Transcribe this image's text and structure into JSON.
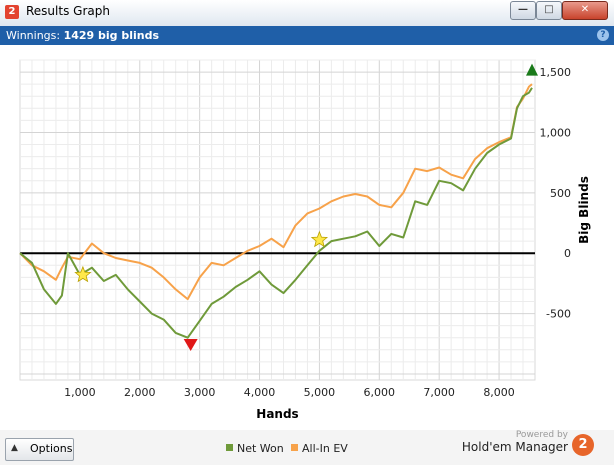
{
  "window": {
    "title": "Results Graph",
    "app_icon": "2",
    "buttons": [
      "minimize",
      "maximize",
      "close"
    ]
  },
  "infobar": {
    "label": "Winnings:",
    "value": "1429 big blinds",
    "help": "?"
  },
  "bottom": {
    "options_label": "Options",
    "powered_by": "Powered by",
    "brand": "Hold'em Manager",
    "logo": "2"
  },
  "colors": {
    "net_won": "#6f9a3a",
    "all_in_ev": "#f7a24a",
    "titlebar_blue": "#1f5fa8"
  },
  "chart_data": {
    "type": "line",
    "xlabel": "Hands",
    "ylabel": "Big Blinds",
    "xlim": [
      0,
      8600
    ],
    "ylim": [
      -1050,
      1600
    ],
    "xticks": [
      1000,
      2000,
      3000,
      4000,
      5000,
      6000,
      7000,
      8000
    ],
    "xtick_labels": [
      "1,000",
      "2,000",
      "3,000",
      "4,000",
      "5,000",
      "6,000",
      "7,000",
      "8,000"
    ],
    "yticks": [
      1500,
      1000,
      500,
      0,
      -500
    ],
    "ytick_labels": [
      "1,500",
      "1,000",
      "500",
      "0",
      "-500"
    ],
    "grid": true,
    "legend_position": "bottom-center",
    "series": [
      {
        "name": "Net Won",
        "color": "#6f9a3a",
        "x": [
          0,
          200,
          400,
          600,
          700,
          800,
          1000,
          1200,
          1400,
          1600,
          1800,
          2000,
          2200,
          2400,
          2600,
          2800,
          3000,
          3200,
          3400,
          3600,
          3800,
          4000,
          4200,
          4400,
          4600,
          4800,
          5000,
          5200,
          5400,
          5600,
          5800,
          6000,
          6200,
          6400,
          6600,
          6800,
          7000,
          7200,
          7400,
          7600,
          7800,
          8000,
          8200,
          8300,
          8400,
          8500,
          8550
        ],
        "y": [
          0,
          -80,
          -300,
          -420,
          -350,
          0,
          -180,
          -120,
          -230,
          -180,
          -300,
          -400,
          -500,
          -550,
          -660,
          -700,
          -560,
          -420,
          -360,
          -280,
          -220,
          -150,
          -260,
          -330,
          -220,
          -100,
          20,
          100,
          120,
          140,
          180,
          60,
          160,
          130,
          430,
          400,
          600,
          580,
          520,
          700,
          830,
          900,
          950,
          1200,
          1300,
          1330,
          1370
        ]
      },
      {
        "name": "All-In EV",
        "color": "#f7a24a",
        "x": [
          0,
          200,
          400,
          600,
          700,
          800,
          1000,
          1200,
          1400,
          1600,
          1800,
          2000,
          2200,
          2400,
          2600,
          2800,
          3000,
          3200,
          3400,
          3600,
          3800,
          4000,
          4200,
          4400,
          4600,
          4800,
          5000,
          5200,
          5400,
          5600,
          5800,
          6000,
          6200,
          6400,
          6600,
          6800,
          7000,
          7200,
          7400,
          7600,
          7800,
          8000,
          8200,
          8300,
          8400,
          8500,
          8550
        ],
        "y": [
          0,
          -100,
          -150,
          -220,
          -120,
          -30,
          -50,
          80,
          0,
          -40,
          -60,
          -80,
          -120,
          -200,
          -300,
          -380,
          -200,
          -80,
          -100,
          -40,
          20,
          60,
          120,
          50,
          230,
          330,
          370,
          430,
          470,
          490,
          470,
          400,
          380,
          500,
          700,
          680,
          710,
          650,
          620,
          780,
          870,
          920,
          960,
          1210,
          1280,
          1380,
          1400
        ]
      }
    ],
    "markers": [
      {
        "type": "star",
        "x": 1050,
        "y": -180,
        "color": "#ffe84a"
      },
      {
        "type": "star",
        "x": 5000,
        "y": 110,
        "color": "#ffe84a"
      },
      {
        "type": "down-triangle",
        "x": 2850,
        "y": -760,
        "color": "#e01818"
      },
      {
        "type": "up-triangle",
        "x": 8550,
        "y": 1520,
        "color": "#1a7a1a"
      }
    ]
  }
}
